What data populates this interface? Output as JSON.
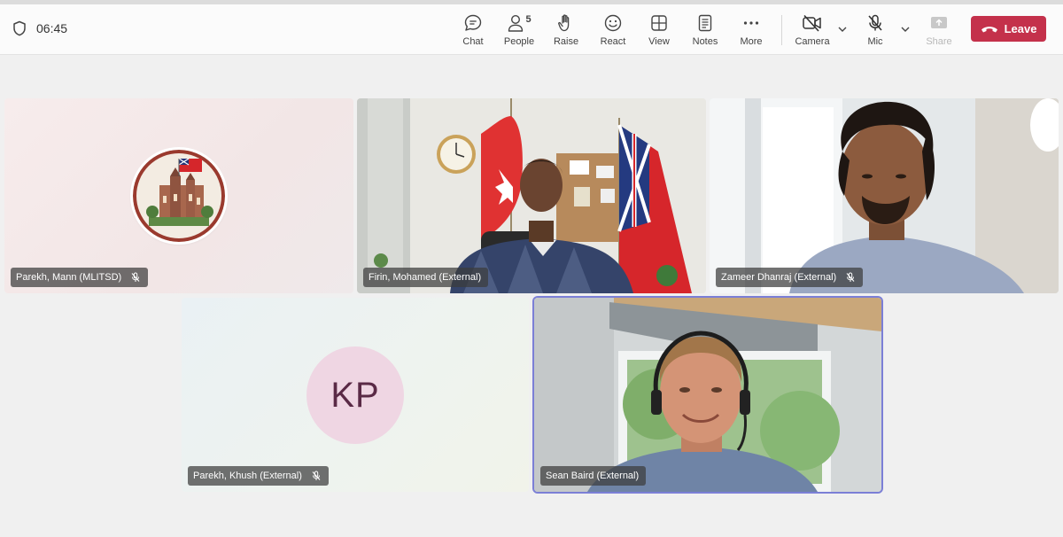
{
  "meeting": {
    "timer": "06:45"
  },
  "toolbar": {
    "chat": "Chat",
    "people": "People",
    "people_count": "5",
    "raise": "Raise",
    "react": "React",
    "view": "View",
    "notes": "Notes",
    "more": "More",
    "camera": "Camera",
    "mic": "Mic",
    "share": "Share",
    "leave": "Leave"
  },
  "participants": [
    {
      "name": "Parekh, Mann (MLITSD)"
    },
    {
      "name": "Firin, Mohamed (External)"
    },
    {
      "name": "Zameer Dhanraj (External)"
    },
    {
      "name": "Parekh, Khush (External)",
      "initials": "KP"
    },
    {
      "name": "Sean Baird (External)"
    }
  ],
  "colors": {
    "leave_button": "#c4314b",
    "active_speaker_border": "#7b7fd6",
    "avatar_bg": "#efd6e3"
  }
}
